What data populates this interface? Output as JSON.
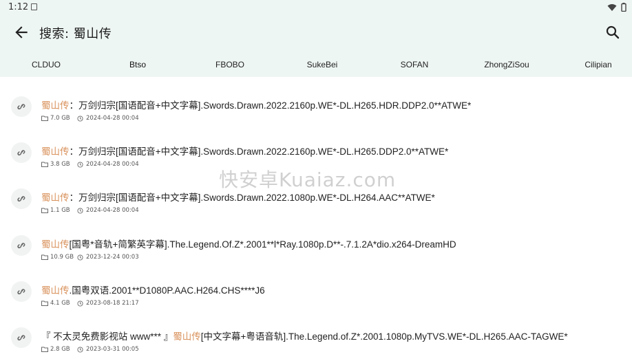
{
  "status": {
    "time": "1:12"
  },
  "appbar": {
    "title": "搜索: 蜀山传"
  },
  "tabs": [
    "CLDUO",
    "Btso",
    "FBOBO",
    "SukeBei",
    "SOFAN",
    "ZhongZiSou",
    "Cilipian"
  ],
  "active_tab": "Btso",
  "results": [
    {
      "prefix": "",
      "highlight": "蜀山传",
      "rest": "：万剑归宗[国语配音+中文字幕].Swords.Drawn.2022.2160p.WE*-DL.H265.HDR.DDP2.0**ATWE*",
      "size": "7.0 GB",
      "date": "2024-04-28 00:04"
    },
    {
      "prefix": "",
      "highlight": "蜀山传",
      "rest": "：万剑归宗[国语配音+中文字幕].Swords.Drawn.2022.2160p.WE*-DL.H265.DDP2.0**ATWE*",
      "size": "3.8 GB",
      "date": "2024-04-28 00:04"
    },
    {
      "prefix": "",
      "highlight": "蜀山传",
      "rest": "：万剑归宗[国语配音+中文字幕].Swords.Drawn.2022.1080p.WE*-DL.H264.AAC**ATWE*",
      "size": "1.1 GB",
      "date": "2024-04-28 00:04"
    },
    {
      "prefix": "",
      "highlight": "蜀山传",
      "rest": "[国粤*音轨+简繁英字幕].The.Legend.Of.Z*.2001**l*Ray.1080p.D**-.7.1.2A*dio.x264-DreamHD",
      "size": "10.9 GB",
      "date": "2023-12-24 00:03"
    },
    {
      "prefix": "",
      "highlight": "蜀山传",
      "rest": ".国粤双语.2001**D1080P.AAC.H264.CHS****J6",
      "size": "4.1 GB",
      "date": "2023-08-18 21:17"
    },
    {
      "prefix": "『 不太灵免费影视站 www*** 』",
      "highlight": "蜀山传",
      "rest": "[中文字幕+粤语音轨].The.Legend.of.Z*.2001.1080p.MyTVS.WE*-DL.H265.AAC-TAGWE*",
      "size": "2.8 GB",
      "date": "2023-03-31 00:05"
    }
  ],
  "watermark": "快安卓Kuaiaz.com"
}
